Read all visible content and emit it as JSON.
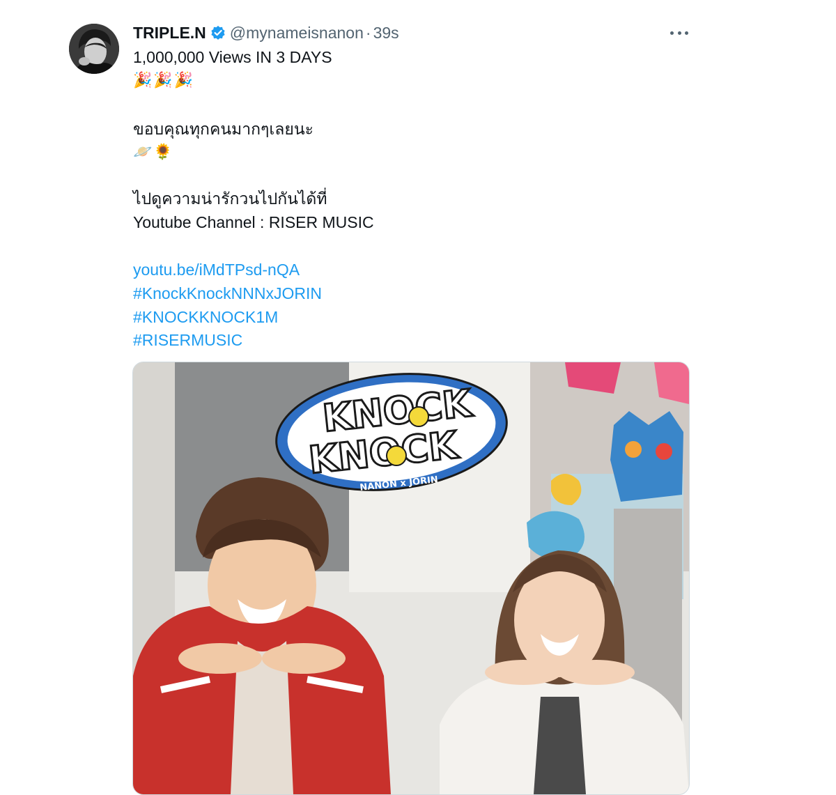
{
  "tweet": {
    "author_name": "TRIPLE.N",
    "handle": "@mynameisnanon",
    "separator": "·",
    "timestamp": "39s",
    "lines": {
      "l1": "1,000,000 Views IN 3 DAYS",
      "l2": "🎉🎉🎉",
      "l3": "ขอบคุณทุกคนมากๆเลยนะ",
      "l4": "🪐🌻",
      "l5": "ไปดูความน่ารักวนไปกันได้ที่",
      "l6": "Youtube Channel : RISER MUSIC",
      "link": "youtu.be/iMdTPsd-nQA",
      "hashtags": [
        "#KnockKnockNNNxJORIN",
        "#KNOCKKNOCK1M",
        "#RISERMUSIC"
      ]
    },
    "media": {
      "logo_top": "KNOCK",
      "logo_bottom": "KNOCK",
      "logo_sub": "NANON x JORIN"
    }
  },
  "colors": {
    "link": "#1d9bf0",
    "verified": "#1d9bf0",
    "secondary_text": "#536471",
    "logo_blue": "#2f6fc4"
  },
  "icons": {
    "verified": "verified-badge-icon",
    "more": "more-options-icon"
  }
}
